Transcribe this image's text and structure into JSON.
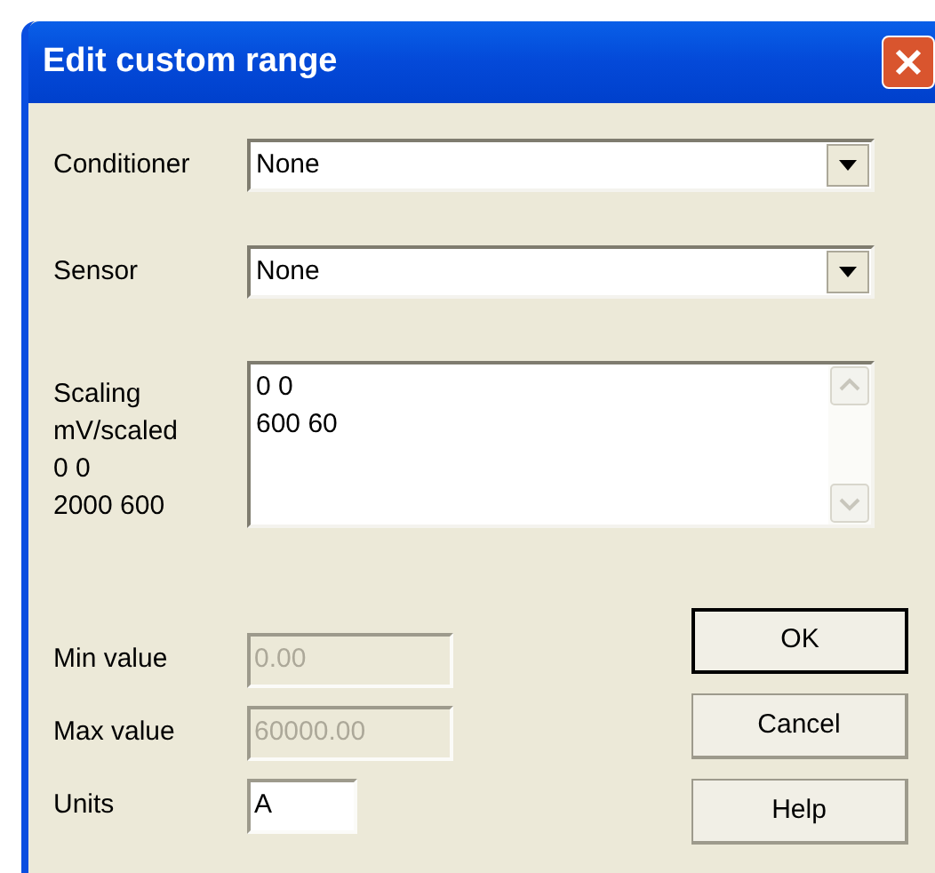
{
  "window": {
    "title": "Edit custom range"
  },
  "fields": [
    {
      "kind": "combo",
      "label": "Conditioner",
      "value": "None"
    },
    {
      "kind": "combo",
      "label": "Sensor",
      "value": "None"
    },
    {
      "kind": "textarea",
      "label_lines": [
        "Scaling",
        "mV/scaled",
        "0 0",
        "2000 600"
      ],
      "value_lines": [
        "0 0",
        "600 60"
      ]
    }
  ],
  "values": [
    {
      "label": "Min value",
      "value": "0.00",
      "disabled": true,
      "kind": "wide"
    },
    {
      "label": "Max value",
      "value": "60000.00",
      "disabled": true,
      "kind": "wide"
    },
    {
      "label": "Units",
      "value": "A",
      "disabled": false,
      "kind": "narrow"
    }
  ],
  "buttons": [
    {
      "label": "OK",
      "default": true
    },
    {
      "label": "Cancel",
      "default": false
    },
    {
      "label": "Help",
      "default": false
    }
  ]
}
